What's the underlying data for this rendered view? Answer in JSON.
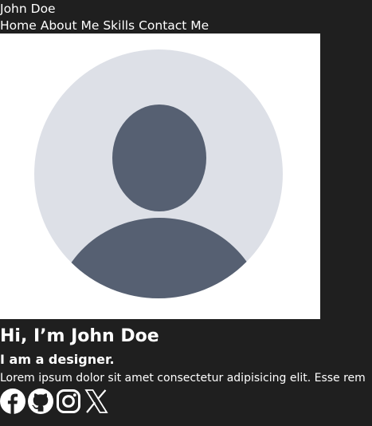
{
  "site": {
    "brand": "John Doe"
  },
  "nav": {
    "items": [
      "Home",
      "About Me",
      "Skills",
      "Contact Me"
    ]
  },
  "hero": {
    "title": "Hi, I’m John Doe",
    "subtitle": "I am a designer.",
    "text": "Lorem ipsum dolor sit amet consectetur adipisicing elit. Esse rem"
  },
  "avatar": {
    "icon": "user-placeholder-icon",
    "bg_circle": "#dde0e7",
    "figure": "#566072"
  },
  "socials": [
    {
      "icon": "facebook-icon"
    },
    {
      "icon": "github-icon"
    },
    {
      "icon": "instagram-icon"
    },
    {
      "icon": "x-icon"
    }
  ],
  "colors": {
    "page_bg": "#1f1f1f",
    "text": "#ffffff",
    "avatar_bg": "#ffffff"
  }
}
